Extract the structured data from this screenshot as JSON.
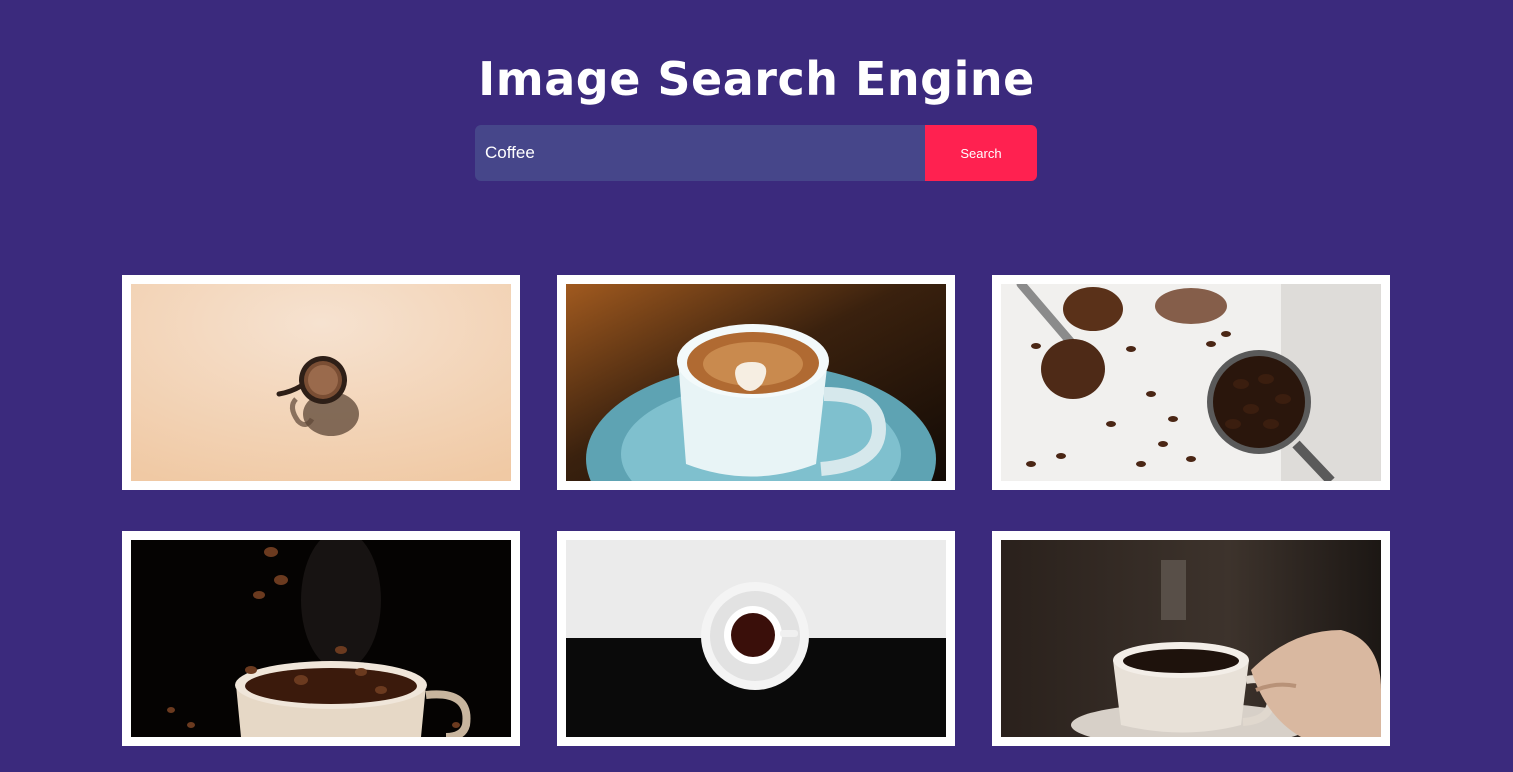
{
  "header": {
    "title": "Image Search Engine"
  },
  "search": {
    "value": "Coffee",
    "button_label": "Search"
  },
  "colors": {
    "background": "#3b2a7d",
    "input_bg": "#46468a",
    "accent": "#ff2150"
  },
  "results": [
    {
      "subject": "coffee cup on peach background"
    },
    {
      "subject": "latte art cup on blue saucer"
    },
    {
      "subject": "ground coffee and beans in scoops"
    },
    {
      "subject": "coffee beans splashing into cup"
    },
    {
      "subject": "espresso cup top view black and white"
    },
    {
      "subject": "hand holding coffee cup"
    }
  ]
}
